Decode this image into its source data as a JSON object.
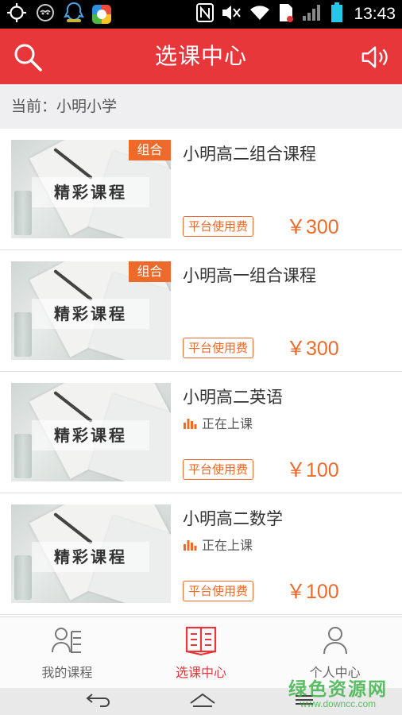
{
  "status_bar": {
    "time": "13:43"
  },
  "header": {
    "title": "选课中心",
    "search_icon": "search-icon",
    "sound_icon": "speaker-icon"
  },
  "school": {
    "label": "当前：小明小学"
  },
  "courses": [
    {
      "title": "小明高二组合课程",
      "tag": "组合",
      "thumb_label": "精彩课程",
      "fee_label": "平台使用费",
      "price": "￥300",
      "status": ""
    },
    {
      "title": "小明高一组合课程",
      "tag": "组合",
      "thumb_label": "精彩课程",
      "fee_label": "平台使用费",
      "price": "￥300",
      "status": ""
    },
    {
      "title": "小明高二英语",
      "tag": "",
      "thumb_label": "精彩课程",
      "fee_label": "平台使用费",
      "price": "￥100",
      "status": "正在上课"
    },
    {
      "title": "小明高二数学",
      "tag": "",
      "thumb_label": "精彩课程",
      "fee_label": "平台使用费",
      "price": "￥100",
      "status": "正在上课"
    }
  ],
  "tabs": [
    {
      "label": "我的课程",
      "icon": "my-courses-icon",
      "active": false
    },
    {
      "label": "选课中心",
      "icon": "book-icon",
      "active": true
    },
    {
      "label": "个人中心",
      "icon": "user-icon",
      "active": false
    }
  ],
  "watermark": {
    "name": "绿色资源网",
    "url": "www.downcc.com"
  },
  "colors": {
    "primary": "#e8373b",
    "accent": "#ee6a2a",
    "background": "#efeff1"
  }
}
